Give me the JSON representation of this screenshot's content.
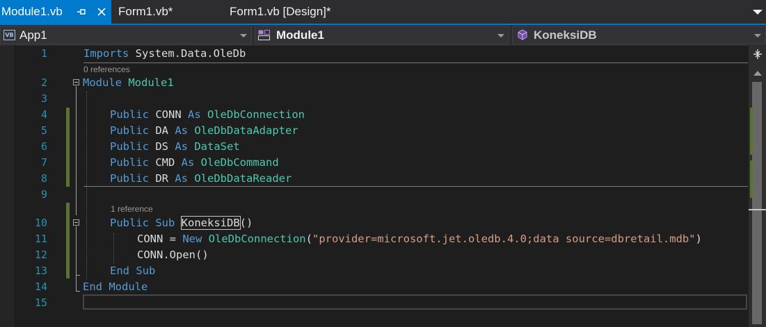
{
  "tabs": [
    {
      "label": "Module1.vb",
      "active": true,
      "pin_icon": "pin-icon",
      "close_icon": "close-icon"
    },
    {
      "label": "Form1.vb*",
      "active": false
    },
    {
      "label": "Form1.vb [Design]*",
      "active": false
    }
  ],
  "navbar": {
    "project": "App1",
    "module": "Module1",
    "member": "KoneksiDB"
  },
  "editor": {
    "line_numbers": [
      "1",
      "2",
      "3",
      "4",
      "5",
      "6",
      "7",
      "8",
      "9",
      "10",
      "11",
      "12",
      "13",
      "14",
      "15"
    ],
    "references": {
      "module": "0 references",
      "sub": "1 reference"
    },
    "lines": {
      "l1": {
        "kw": "Imports",
        "rest": " System.Data.OleDb"
      },
      "l2": {
        "kw": "Module",
        "name": "Module1"
      },
      "l4": {
        "kw": "Public",
        "var": " CONN ",
        "as": "As",
        "type": " OleDbConnection"
      },
      "l5": {
        "kw": "Public",
        "var": " DA ",
        "as": "As",
        "type": " OleDbDataAdapter"
      },
      "l6": {
        "kw": "Public",
        "var": " DS ",
        "as": "As",
        "type": " DataSet"
      },
      "l7": {
        "kw": "Public",
        "var": " CMD ",
        "as": "As",
        "type": " OleDbCommand"
      },
      "l8": {
        "kw": "Public",
        "var": " DR ",
        "as": "As",
        "type": " OleDbDataReader"
      },
      "l10": {
        "kw": "Public Sub",
        "name": "KoneksiDB",
        "rest": "()"
      },
      "l11": {
        "pre": "CONN = ",
        "kw": "New",
        "type": " OleDbConnection",
        "open": "(",
        "str": "\"provider=microsoft.jet.oledb.4.0;data source=dbretail.mdb\"",
        "close": ")"
      },
      "l12": {
        "text": "CONN.Open()"
      },
      "l13": {
        "kw": "End Sub"
      },
      "l14": {
        "kw": "End Module"
      }
    }
  },
  "colors": {
    "accent": "#007acc",
    "keyword": "#569cd6",
    "type": "#4ec9b0",
    "string": "#d69d85",
    "line_number": "#2b91af",
    "change_bar": "#577430"
  }
}
